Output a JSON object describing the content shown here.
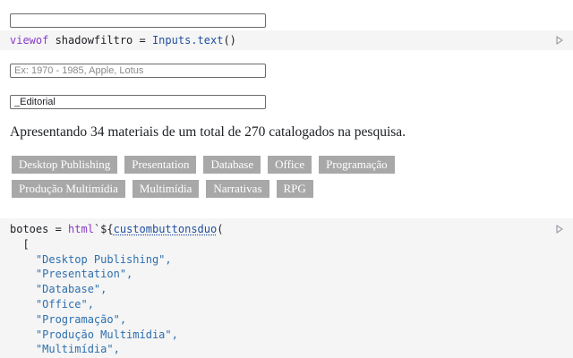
{
  "inputs": {
    "top_value": "",
    "search_placeholder": "Ex: 1970 - 1985, Apple, Lotus",
    "editorial_value": "_Editorial"
  },
  "cell_viewof": {
    "kw": "viewof",
    "var": " shadowfiltro = ",
    "fn": "Inputs.text",
    "end": "()"
  },
  "result_text": "Apresentando 34 materiais de um total de 270 catalogados na pesquisa.",
  "buttons": {
    "row1": [
      "Desktop Publishing",
      "Presentation",
      "Database",
      "Office",
      "Programação"
    ],
    "row2": [
      "Produção Multimídia",
      "Multimídia",
      "Narrativas",
      "RPG"
    ]
  },
  "cell_botoes": {
    "line1_a": "botoes = ",
    "line1_kw": "html",
    "line1_b": "`${",
    "line1_fn": "custombuttonsduo",
    "line1_c": "(",
    "line2": "  [",
    "strings": [
      "\"Desktop Publishing\",",
      "\"Presentation\",",
      "\"Database\",",
      "\"Office\",",
      "\"Programação\",",
      "\"Produção Multimídia\",",
      "\"Multimídia\","
    ]
  },
  "icons": {
    "run": "run-cell-icon"
  }
}
